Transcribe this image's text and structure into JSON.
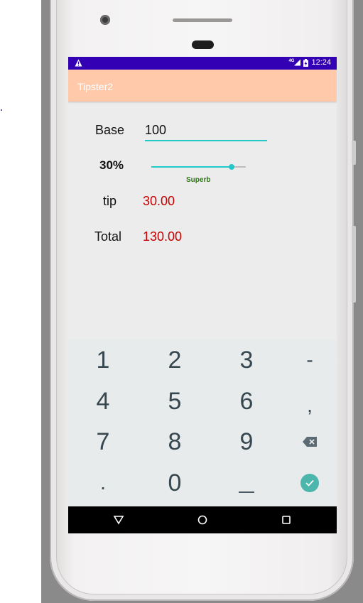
{
  "status_bar": {
    "warning_icon": "warning-triangle-icon",
    "network_label": "4G",
    "time": "12:24",
    "color": "#3300b3"
  },
  "app_bar": {
    "title": "Tipster2",
    "color": "#ffc9aa"
  },
  "form": {
    "base_label": "Base",
    "base_value": "100",
    "tip_percent_label": "30%",
    "tip_percent_value": 30,
    "tip_rating": "Superb",
    "tip_label": "tip",
    "tip_value": "30.00",
    "total_label": "Total",
    "total_value": "130.00",
    "accent_color": "#23c8c8",
    "result_color": "#c40000"
  },
  "keyboard": {
    "rows": [
      [
        "1",
        "2",
        "3",
        "-"
      ],
      [
        "4",
        "5",
        "6",
        ","
      ],
      [
        "7",
        "8",
        "9",
        "backspace"
      ],
      [
        ".",
        "0",
        "_",
        "done"
      ]
    ],
    "backspace_icon": "backspace-icon",
    "done_icon": "check-icon"
  },
  "nav_bar": {
    "back_icon": "back-triangle-icon",
    "home_icon": "home-circle-icon",
    "recents_icon": "recents-square-icon"
  }
}
